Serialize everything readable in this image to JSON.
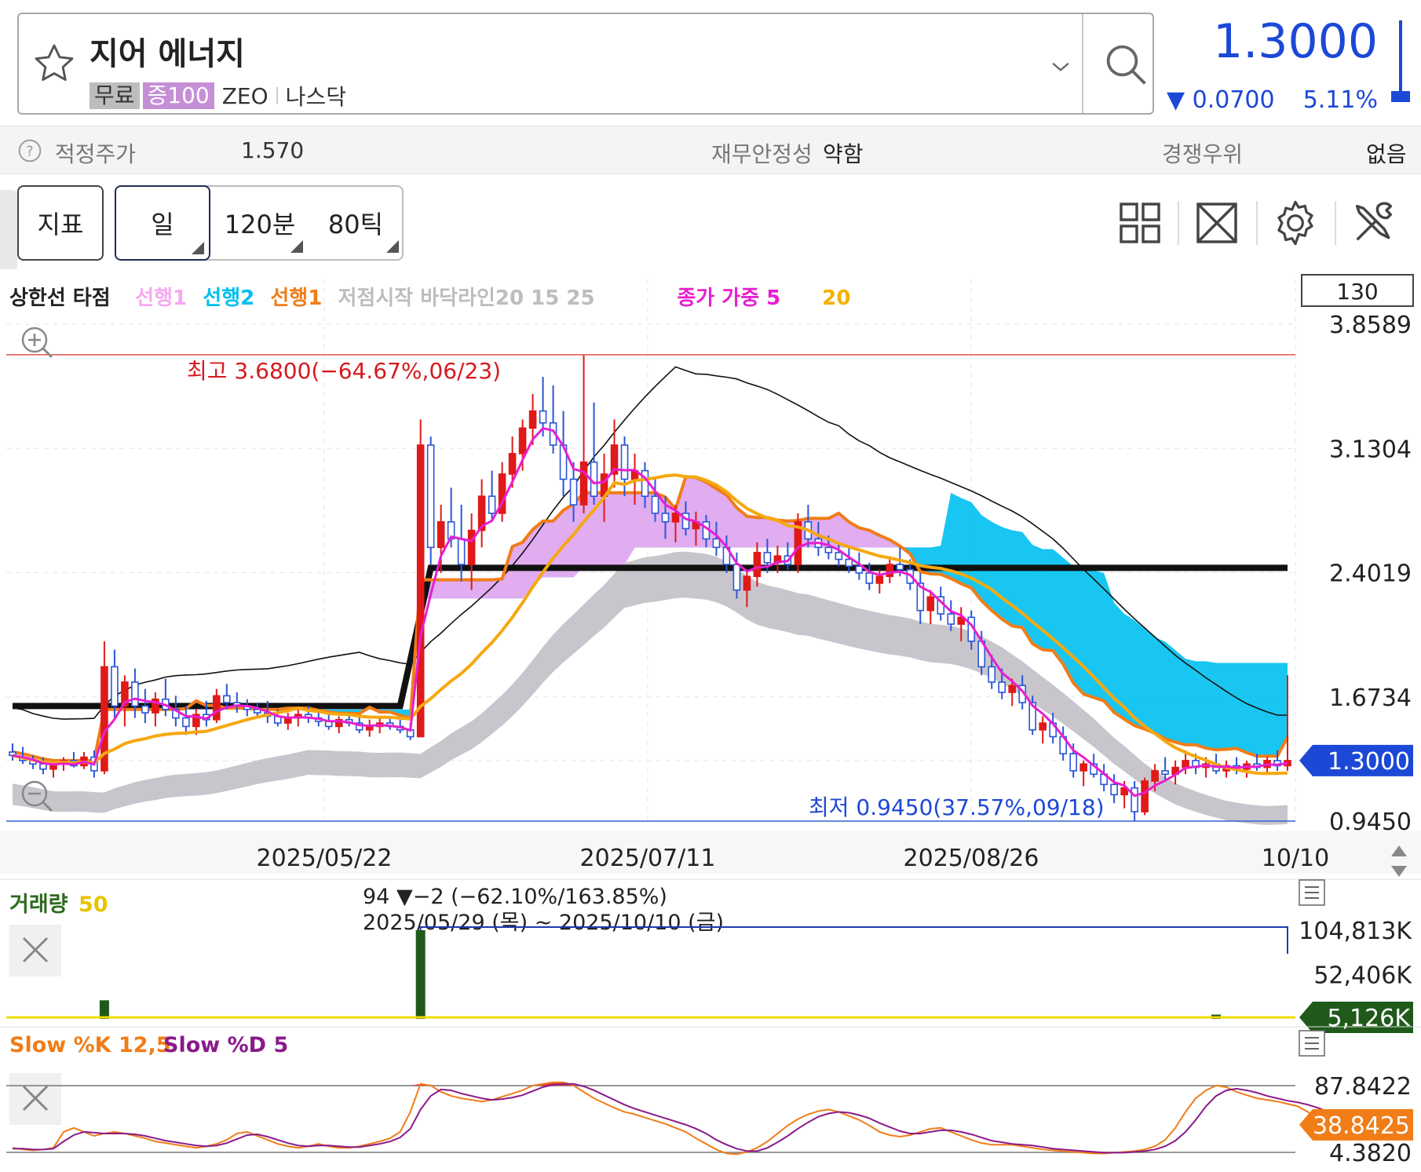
{
  "header": {
    "stock_name": "지어 에너지",
    "tag_free": "무료",
    "tag_margin": "증100",
    "ticker": "ZEO",
    "market": "나스닥",
    "price": "1.3000",
    "change": "▼ 0.0700",
    "change_pct": "5.11%",
    "color_down": "#1c48d6"
  },
  "info": {
    "fair_price_label": "적정주가",
    "fair_price_value": "1.570",
    "stability_label": "재무안정성",
    "stability_value": "약함",
    "advantage_label": "경쟁우위",
    "advantage_value": "없음"
  },
  "toolbar": {
    "indicator": "지표",
    "day": "일",
    "min120": "120분",
    "tick80": "80틱",
    "icons": [
      "layout-grid-icon",
      "expand-icon",
      "gear-icon",
      "tools-icon"
    ]
  },
  "price_chart": {
    "legend": [
      {
        "text": "상한선 타점",
        "color": "#222222"
      },
      {
        "text": "선행1",
        "color": "#f7a8f0"
      },
      {
        "text": "선행2",
        "color": "#00c0f0"
      },
      {
        "text": "선행1",
        "color": "#f07d18"
      },
      {
        "text": "저점시작 바닥라인20 15 25",
        "color": "#bdbdbd"
      },
      {
        "text": "종가 가중 5",
        "color": "#e81ed0"
      },
      {
        "text": "20",
        "color": "#f5b000"
      }
    ],
    "count_box": "130",
    "high_label": "최고 3.6800(−64.67%,06/23)",
    "low_label": "최저 0.9450(37.57%,09/18)",
    "current_badge": "1.3000",
    "dates": [
      "2025/05/22",
      "2025/07/11",
      "2025/08/26",
      "10/10"
    ]
  },
  "volume": {
    "title": "거래량",
    "period": "50",
    "summary": "94 ▼−2 (−62.10%/163.85%)",
    "range": "2025/05/29 (목) ~ 2025/10/10 (금)",
    "current_badge": "5,126K"
  },
  "stoch": {
    "k_label": "Slow %K 12,5",
    "d_label": "Slow %D 5",
    "current_badge": "38.8425"
  },
  "chart_data": [
    {
      "type": "candlestick",
      "title": "",
      "yticks": [
        "3.8589",
        "3.1304",
        "2.4019",
        "1.6734",
        "1.3000",
        "0.9450"
      ],
      "ylim": [
        0.945,
        3.8589
      ],
      "x_ticks": [
        "2025/05/22",
        "2025/07/11",
        "2025/08/26",
        "10/10"
      ],
      "high": 3.68,
      "low": 0.945,
      "last": 1.3,
      "ohlc": [
        [
          1.35,
          1.4,
          1.3,
          1.33
        ],
        [
          1.32,
          1.38,
          1.28,
          1.3
        ],
        [
          1.3,
          1.33,
          1.25,
          1.28
        ],
        [
          1.28,
          1.32,
          1.22,
          1.25
        ],
        [
          1.25,
          1.3,
          1.2,
          1.28
        ],
        [
          1.28,
          1.32,
          1.24,
          1.3
        ],
        [
          1.3,
          1.35,
          1.26,
          1.27
        ],
        [
          1.27,
          1.35,
          1.25,
          1.32
        ],
        [
          1.32,
          1.36,
          1.2,
          1.24
        ],
        [
          1.24,
          2.0,
          1.22,
          1.85
        ],
        [
          1.85,
          1.95,
          1.55,
          1.62
        ],
        [
          1.62,
          1.8,
          1.5,
          1.76
        ],
        [
          1.76,
          1.84,
          1.55,
          1.62
        ],
        [
          1.62,
          1.72,
          1.52,
          1.58
        ],
        [
          1.58,
          1.7,
          1.5,
          1.66
        ],
        [
          1.66,
          1.78,
          1.56,
          1.6
        ],
        [
          1.6,
          1.68,
          1.5,
          1.55
        ],
        [
          1.55,
          1.62,
          1.45,
          1.5
        ],
        [
          1.5,
          1.6,
          1.45,
          1.57
        ],
        [
          1.57,
          1.65,
          1.5,
          1.54
        ],
        [
          1.54,
          1.72,
          1.52,
          1.68
        ],
        [
          1.68,
          1.75,
          1.6,
          1.64
        ],
        [
          1.64,
          1.7,
          1.58,
          1.62
        ],
        [
          1.62,
          1.66,
          1.56,
          1.6
        ],
        [
          1.6,
          1.64,
          1.55,
          1.58
        ],
        [
          1.58,
          1.65,
          1.52,
          1.56
        ],
        [
          1.56,
          1.6,
          1.5,
          1.52
        ],
        [
          1.52,
          1.58,
          1.48,
          1.55
        ],
        [
          1.55,
          1.6,
          1.5,
          1.57
        ],
        [
          1.57,
          1.62,
          1.52,
          1.55
        ],
        [
          1.55,
          1.6,
          1.5,
          1.53
        ],
        [
          1.53,
          1.58,
          1.48,
          1.5
        ],
        [
          1.5,
          1.56,
          1.46,
          1.54
        ],
        [
          1.54,
          1.58,
          1.5,
          1.52
        ],
        [
          1.52,
          1.56,
          1.46,
          1.48
        ],
        [
          1.48,
          1.54,
          1.44,
          1.5
        ],
        [
          1.5,
          1.56,
          1.46,
          1.52
        ],
        [
          1.52,
          1.56,
          1.48,
          1.5
        ],
        [
          1.5,
          1.54,
          1.46,
          1.48
        ],
        [
          1.48,
          1.52,
          1.42,
          1.44
        ],
        [
          1.44,
          3.3,
          1.44,
          3.15
        ],
        [
          3.15,
          3.2,
          2.45,
          2.55
        ],
        [
          2.55,
          2.8,
          2.4,
          2.7
        ],
        [
          2.7,
          2.9,
          2.55,
          2.6
        ],
        [
          2.6,
          2.8,
          2.35,
          2.45
        ],
        [
          2.45,
          2.75,
          2.3,
          2.65
        ],
        [
          2.65,
          2.95,
          2.55,
          2.85
        ],
        [
          2.85,
          3.0,
          2.7,
          2.75
        ],
        [
          2.75,
          3.05,
          2.7,
          2.98
        ],
        [
          2.98,
          3.2,
          2.9,
          3.1
        ],
        [
          3.1,
          3.3,
          3.0,
          3.25
        ],
        [
          3.25,
          3.45,
          3.15,
          3.35
        ],
        [
          3.35,
          3.55,
          3.2,
          3.28
        ],
        [
          3.28,
          3.5,
          3.1,
          3.15
        ],
        [
          3.15,
          3.35,
          2.85,
          2.95
        ],
        [
          2.95,
          3.05,
          2.7,
          2.8
        ],
        [
          2.8,
          3.68,
          2.75,
          3.05
        ],
        [
          3.05,
          3.4,
          2.8,
          2.85
        ],
        [
          2.85,
          3.1,
          2.7,
          2.98
        ],
        [
          2.98,
          3.3,
          2.9,
          3.15
        ],
        [
          3.15,
          3.2,
          2.85,
          2.95
        ],
        [
          2.95,
          3.1,
          2.8,
          3.0
        ],
        [
          3.0,
          3.05,
          2.78,
          2.85
        ],
        [
          2.85,
          2.95,
          2.7,
          2.75
        ],
        [
          2.75,
          2.85,
          2.6,
          2.7
        ],
        [
          2.7,
          2.8,
          2.58,
          2.75
        ],
        [
          2.75,
          2.82,
          2.62,
          2.66
        ],
        [
          2.66,
          2.76,
          2.56,
          2.7
        ],
        [
          2.7,
          2.74,
          2.55,
          2.6
        ],
        [
          2.6,
          2.7,
          2.5,
          2.55
        ],
        [
          2.55,
          2.62,
          2.4,
          2.45
        ],
        [
          2.45,
          2.52,
          2.25,
          2.3
        ],
        [
          2.3,
          2.42,
          2.2,
          2.38
        ],
        [
          2.38,
          2.58,
          2.32,
          2.52
        ],
        [
          2.52,
          2.6,
          2.4,
          2.46
        ],
        [
          2.46,
          2.56,
          2.4,
          2.5
        ],
        [
          2.5,
          2.58,
          2.42,
          2.45
        ],
        [
          2.45,
          2.75,
          2.4,
          2.7
        ],
        [
          2.7,
          2.8,
          2.55,
          2.6
        ],
        [
          2.6,
          2.7,
          2.5,
          2.55
        ],
        [
          2.55,
          2.62,
          2.48,
          2.52
        ],
        [
          2.52,
          2.58,
          2.44,
          2.48
        ],
        [
          2.48,
          2.56,
          2.4,
          2.44
        ],
        [
          2.44,
          2.52,
          2.36,
          2.4
        ],
        [
          2.4,
          2.46,
          2.3,
          2.34
        ],
        [
          2.34,
          2.42,
          2.28,
          2.38
        ],
        [
          2.38,
          2.48,
          2.34,
          2.45
        ],
        [
          2.45,
          2.55,
          2.38,
          2.42
        ],
        [
          2.42,
          2.48,
          2.3,
          2.34
        ],
        [
          2.34,
          2.4,
          2.1,
          2.18
        ],
        [
          2.18,
          2.3,
          2.1,
          2.26
        ],
        [
          2.26,
          2.32,
          2.12,
          2.16
        ],
        [
          2.16,
          2.24,
          2.06,
          2.1
        ],
        [
          2.1,
          2.2,
          2.0,
          2.14
        ],
        [
          2.14,
          2.18,
          1.95,
          2.0
        ],
        [
          2.0,
          2.06,
          1.8,
          1.85
        ],
        [
          1.85,
          1.92,
          1.72,
          1.76
        ],
        [
          1.76,
          1.84,
          1.66,
          1.7
        ],
        [
          1.7,
          1.78,
          1.62,
          1.74
        ],
        [
          1.74,
          1.8,
          1.6,
          1.64
        ],
        [
          1.64,
          1.68,
          1.45,
          1.48
        ],
        [
          1.48,
          1.56,
          1.4,
          1.52
        ],
        [
          1.52,
          1.58,
          1.4,
          1.44
        ],
        [
          1.44,
          1.5,
          1.3,
          1.34
        ],
        [
          1.34,
          1.4,
          1.2,
          1.24
        ],
        [
          1.24,
          1.3,
          1.15,
          1.28
        ],
        [
          1.28,
          1.34,
          1.2,
          1.22
        ],
        [
          1.22,
          1.28,
          1.12,
          1.16
        ],
        [
          1.16,
          1.22,
          1.05,
          1.1
        ],
        [
          1.1,
          1.18,
          1.02,
          1.14
        ],
        [
          1.14,
          1.18,
          0.945,
          1.0
        ],
        [
          1.0,
          1.2,
          0.98,
          1.18
        ],
        [
          1.18,
          1.28,
          1.12,
          1.24
        ],
        [
          1.24,
          1.32,
          1.18,
          1.22
        ],
        [
          1.22,
          1.3,
          1.16,
          1.26
        ],
        [
          1.26,
          1.36,
          1.22,
          1.3
        ],
        [
          1.3,
          1.34,
          1.22,
          1.26
        ],
        [
          1.26,
          1.32,
          1.2,
          1.28
        ],
        [
          1.28,
          1.34,
          1.22,
          1.24
        ],
        [
          1.24,
          1.3,
          1.2,
          1.27
        ],
        [
          1.27,
          1.32,
          1.22,
          1.25
        ],
        [
          1.25,
          1.3,
          1.2,
          1.28
        ],
        [
          1.28,
          1.34,
          1.24,
          1.26
        ],
        [
          1.26,
          1.32,
          1.22,
          1.3
        ],
        [
          1.3,
          1.36,
          1.24,
          1.27
        ],
        [
          1.27,
          1.8,
          1.24,
          1.3
        ]
      ]
    },
    {
      "type": "bar",
      "title": "",
      "yticks": [
        "104,813K",
        "52,406K",
        "5,126K"
      ],
      "ylim": [
        0,
        104813
      ],
      "values_note_free": true,
      "spikes": [
        {
          "index": 9,
          "value": 22000
        },
        {
          "index": 40,
          "value": 104813
        },
        {
          "index": 118,
          "value": 5126
        },
        {
          "index": 129,
          "value": 5126
        }
      ]
    },
    {
      "type": "line",
      "title": "",
      "yticks": [
        "87.8422",
        "38.8425",
        "4.3820"
      ],
      "ylim": [
        0,
        100
      ],
      "series": [
        {
          "name": "Slow %K 12,5",
          "color": "#f07d18"
        },
        {
          "name": "Slow %D 5",
          "color": "#8a1a8a"
        }
      ],
      "k_values": [
        10,
        8,
        7,
        8,
        10,
        30,
        35,
        30,
        25,
        28,
        30,
        28,
        25,
        22,
        18,
        16,
        14,
        12,
        10,
        12,
        15,
        20,
        28,
        30,
        25,
        20,
        15,
        12,
        10,
        12,
        15,
        12,
        10,
        10,
        12,
        15,
        18,
        22,
        30,
        55,
        90,
        88,
        80,
        75,
        72,
        70,
        68,
        70,
        74,
        78,
        82,
        88,
        90,
        92,
        92,
        88,
        80,
        72,
        66,
        60,
        55,
        52,
        48,
        44,
        40,
        35,
        30,
        22,
        15,
        8,
        3,
        2,
        5,
        10,
        18,
        28,
        38,
        46,
        52,
        56,
        58,
        55,
        50,
        45,
        38,
        30,
        26,
        24,
        26,
        30,
        34,
        35,
        30,
        25,
        20,
        16,
        14,
        14,
        14,
        12,
        10,
        8,
        7,
        6,
        5,
        4,
        3,
        3,
        4,
        5,
        6,
        8,
        12,
        20,
        35,
        55,
        72,
        82,
        88,
        86,
        80,
        76,
        72,
        70,
        68,
        65,
        62,
        55,
        45,
        38.84
      ],
      "d_values": [
        9,
        9,
        8,
        8,
        9,
        18,
        26,
        30,
        29,
        28,
        28,
        28,
        27,
        25,
        22,
        19,
        17,
        15,
        13,
        12,
        13,
        16,
        21,
        26,
        27,
        24,
        20,
        16,
        13,
        12,
        13,
        13,
        12,
        11,
        11,
        13,
        15,
        18,
        23,
        34,
        58,
        75,
        83,
        82,
        78,
        75,
        72,
        70,
        71,
        73,
        76,
        81,
        86,
        89,
        90,
        90,
        87,
        82,
        76,
        70,
        64,
        59,
        55,
        51,
        47,
        43,
        39,
        34,
        28,
        20,
        14,
        9,
        6,
        6,
        10,
        17,
        25,
        34,
        42,
        49,
        53,
        55,
        54,
        51,
        47,
        41,
        36,
        31,
        28,
        28,
        30,
        32,
        32,
        30,
        27,
        23,
        19,
        17,
        15,
        14,
        13,
        11,
        9,
        8,
        7,
        6,
        5,
        4,
        4,
        4,
        5,
        6,
        8,
        12,
        19,
        30,
        45,
        62,
        75,
        82,
        84,
        82,
        79,
        75,
        72,
        69,
        67,
        64,
        60,
        55
      ]
    }
  ]
}
